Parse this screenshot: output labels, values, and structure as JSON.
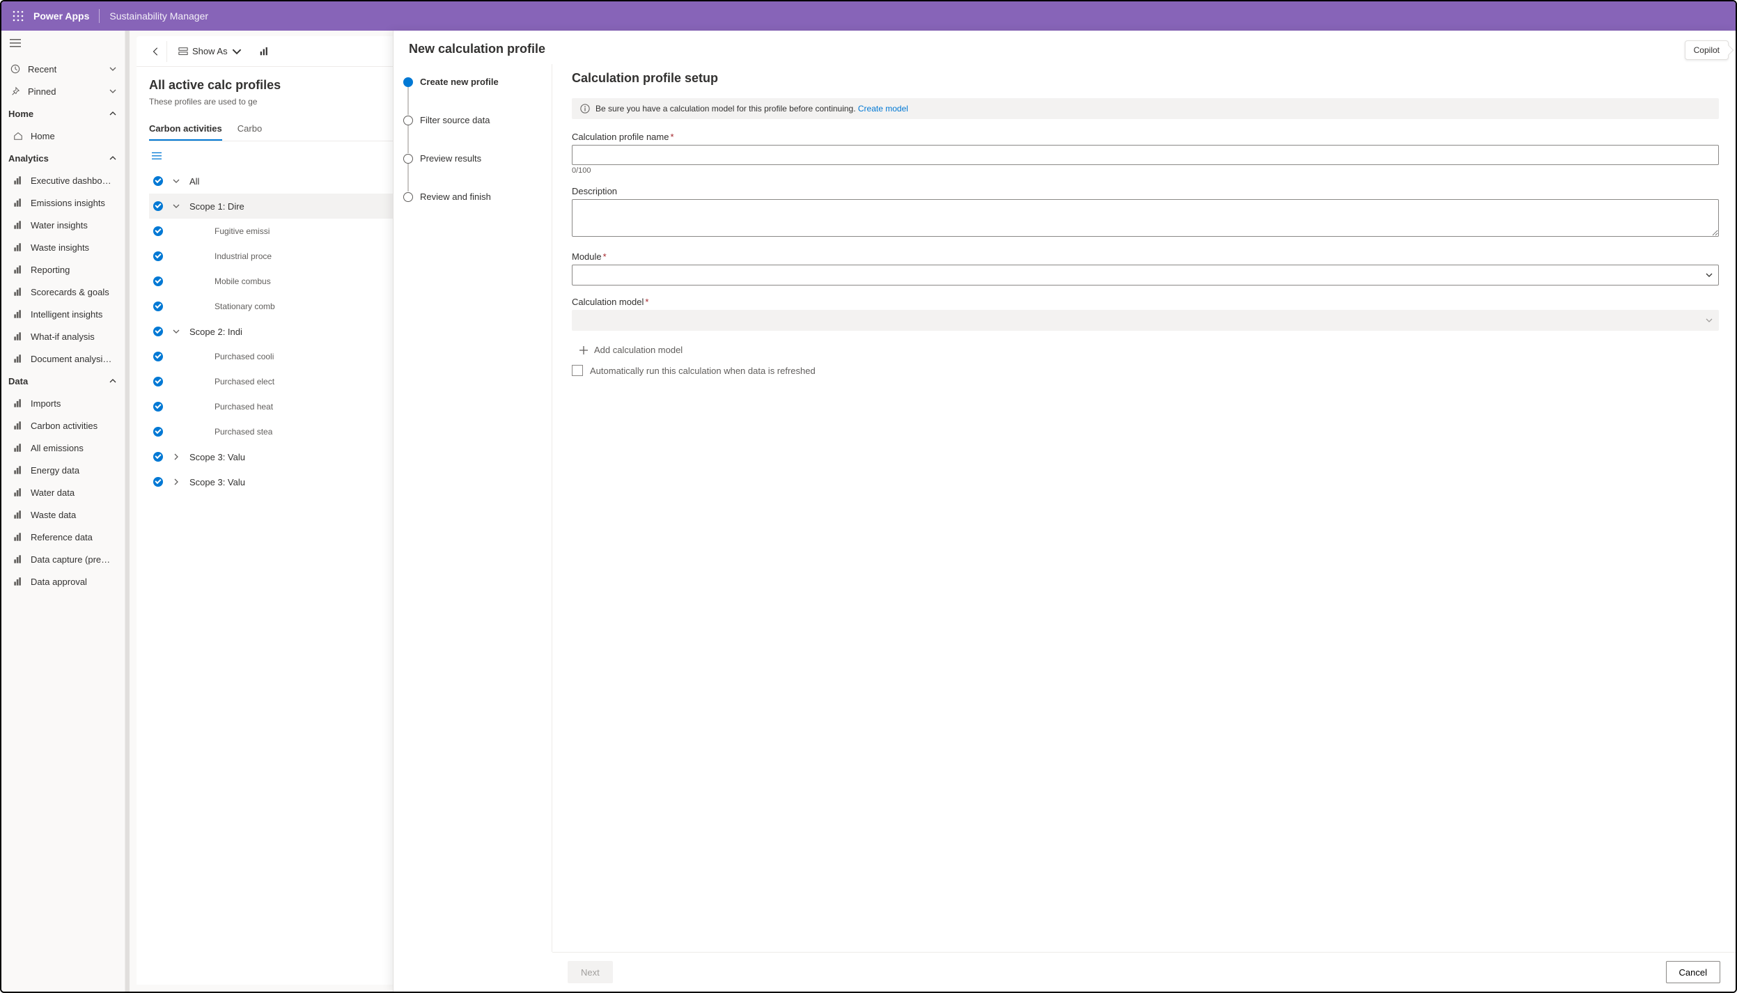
{
  "header": {
    "brand": "Power Apps",
    "appname": "Sustainability Manager"
  },
  "sidebar": {
    "top": [
      {
        "label": "Recent",
        "chev": true
      },
      {
        "label": "Pinned",
        "chev": true
      }
    ],
    "groups": [
      {
        "label": "Home",
        "items": [
          {
            "label": "Home"
          }
        ]
      },
      {
        "label": "Analytics",
        "items": [
          {
            "label": "Executive dashbo…"
          },
          {
            "label": "Emissions insights"
          },
          {
            "label": "Water insights"
          },
          {
            "label": "Waste insights"
          },
          {
            "label": "Reporting"
          },
          {
            "label": "Scorecards & goals"
          },
          {
            "label": "Intelligent insights"
          },
          {
            "label": "What-if analysis"
          },
          {
            "label": "Document analysi…"
          }
        ]
      },
      {
        "label": "Data",
        "items": [
          {
            "label": "Imports"
          },
          {
            "label": "Carbon activities"
          },
          {
            "label": "All emissions"
          },
          {
            "label": "Energy data"
          },
          {
            "label": "Water data"
          },
          {
            "label": "Waste data"
          },
          {
            "label": "Reference data"
          },
          {
            "label": "Data capture (pre…"
          },
          {
            "label": "Data approval"
          }
        ]
      }
    ]
  },
  "cmdbar": {
    "showas": "Show As"
  },
  "list": {
    "title": "All active calc profiles",
    "subtitle": "These profiles are used to ge",
    "tabs": [
      "Carbon activities",
      "Carbo"
    ],
    "all": "All",
    "rows": [
      {
        "type": "group",
        "label": "Scope 1: Dire",
        "expanded": true,
        "selected": true
      },
      {
        "type": "child",
        "label": "Fugitive emissi"
      },
      {
        "type": "child",
        "label": "Industrial proce"
      },
      {
        "type": "child",
        "label": "Mobile combus"
      },
      {
        "type": "child",
        "label": "Stationary comb"
      },
      {
        "type": "group",
        "label": "Scope 2: Indi",
        "expanded": true
      },
      {
        "type": "child",
        "label": "Purchased cooli"
      },
      {
        "type": "child",
        "label": "Purchased elect"
      },
      {
        "type": "child",
        "label": "Purchased heat"
      },
      {
        "type": "child",
        "label": "Purchased stea"
      },
      {
        "type": "group",
        "label": "Scope 3: Valu",
        "expanded": false
      },
      {
        "type": "group",
        "label": "Scope 3: Valu",
        "expanded": false
      }
    ]
  },
  "panel": {
    "title": "New calculation profile",
    "steps": [
      "Create new profile",
      "Filter source data",
      "Preview results",
      "Review and finish"
    ],
    "form_title": "Calculation profile setup",
    "info_text": "Be sure you have a calculation model for this profile before continuing. ",
    "info_link": "Create model",
    "name_label": "Calculation profile name",
    "name_hint": "0/100",
    "desc_label": "Description",
    "module_label": "Module",
    "model_label": "Calculation model",
    "add_model": "Add calculation model",
    "autorun": "Automatically run this calculation when data is refreshed",
    "next": "Next",
    "cancel": "Cancel"
  },
  "copilot": "Copilot"
}
